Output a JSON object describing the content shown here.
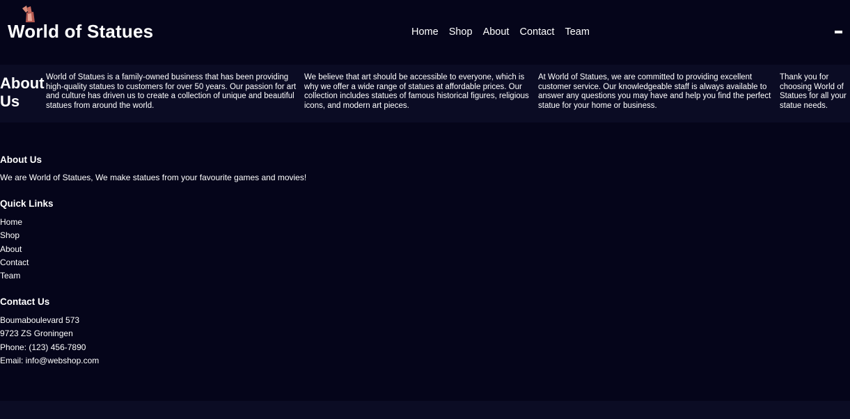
{
  "header": {
    "title": "World of Statues",
    "logo_icon": "statue-icon",
    "nav": [
      "Home",
      "Shop",
      "About",
      "Contact",
      "Team"
    ],
    "menu_icon": "minus-icon"
  },
  "about_band": {
    "heading": "About Us",
    "paragraphs": [
      "World of Statues is a family-owned business that has been providing high-quality statues to customers for over 50 years. Our passion for art and culture has driven us to create a collection of unique and beautiful statues from around the world.",
      "We believe that art should be accessible to everyone, which is why we offer a wide range of statues at affordable prices. Our collection includes statues of famous historical figures, religious icons, and modern art pieces.",
      "At World of Statues, we are committed to providing excellent customer service. Our knowledgeable staff is always available to answer any questions you may have and help you find the perfect statue for your home or business.",
      "Thank you for choosing World of Statues for all your statue needs."
    ]
  },
  "footer": {
    "about": {
      "title": "About Us",
      "text": "We are World of Statues, We make statues from your favourite games and movies!"
    },
    "quick_links": {
      "title": "Quick Links",
      "links": [
        "Home",
        "Shop",
        "About",
        "Contact",
        "Team"
      ]
    },
    "contact": {
      "title": "Contact Us",
      "address1": "Boumaboulevard 573",
      "address2": "9723 ZS Groningen",
      "phone": "Phone: (123) 456-7890",
      "email": "Email: info@webshop.com"
    }
  },
  "colors": {
    "background": "#05051a",
    "band": "#0b0c24",
    "text": "#ffffff",
    "logo": "#c76a5e"
  }
}
